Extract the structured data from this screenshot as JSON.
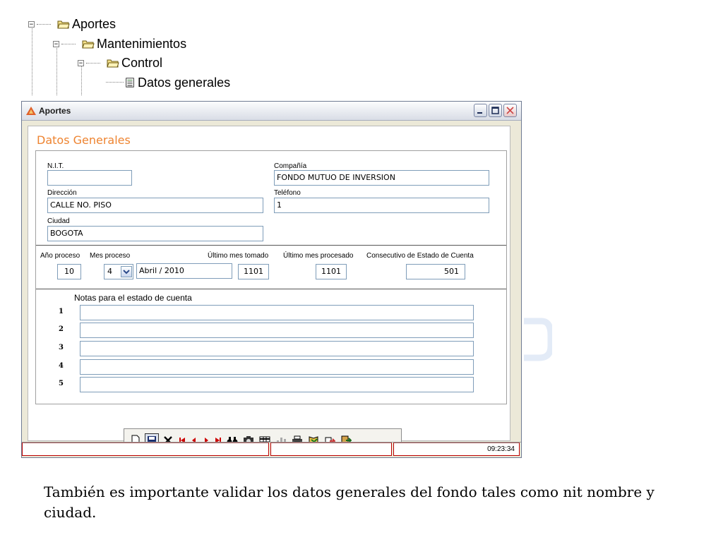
{
  "tree": {
    "items": [
      {
        "label": "Aportes",
        "level": 0
      },
      {
        "label": "Mantenimientos",
        "level": 1
      },
      {
        "label": "Control",
        "level": 2
      },
      {
        "label": "Datos generales",
        "level": 3
      }
    ]
  },
  "window": {
    "title": "Aportes",
    "section_title": "Datos Generales",
    "fields": {
      "nit_label": "N.I.T.",
      "nit_value": "",
      "compania_label": "Compañía",
      "compania_value": "FONDO MUTUO DE INVERSION",
      "direccion_label": "Dirección",
      "direccion_value": "CALLE  NO.  PISO",
      "telefono_label": "Teléfono",
      "telefono_value": "1",
      "ciudad_label": "Ciudad",
      "ciudad_value": "BOGOTA"
    },
    "period": {
      "anio_label": "Año proceso",
      "anio_value": "10",
      "mes_label": "Mes proceso",
      "mes_value": "4",
      "mes_texto": "Abril / 2010",
      "ultimo_tomado_label": "Último mes tomado",
      "ultimo_tomado_value": "1101",
      "ultimo_procesado_label": "Último mes procesado",
      "ultimo_procesado_value": "1101",
      "consecutivo_label": "Consecutivo de Estado de Cuenta",
      "consecutivo_value": "501"
    },
    "notes": {
      "label": "Notas para el estado de cuenta",
      "rows": [
        "1",
        "2",
        "3",
        "4",
        "5"
      ]
    },
    "toolbar": [
      "new-icon",
      "save-icon",
      "delete-icon",
      "first-record-icon",
      "previous-record-icon",
      "next-record-icon",
      "last-record-icon",
      "binoculars-icon",
      "camera-icon",
      "grid-icon",
      "chart-icon",
      "print-icon",
      "import-icon",
      "export-icon",
      "exit-icon"
    ],
    "status": {
      "time": "09:23:34"
    }
  },
  "caption": "También es importante validar los datos generales del fondo tales como nit nombre y ciudad."
}
